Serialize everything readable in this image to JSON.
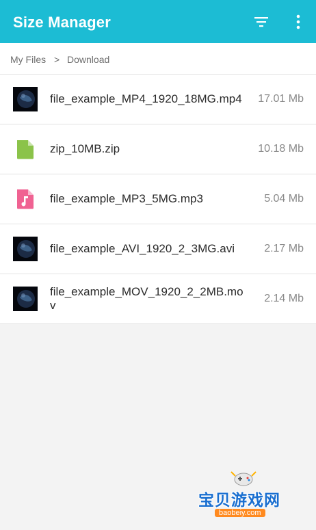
{
  "app": {
    "title": "Size Manager"
  },
  "breadcrumb": {
    "root": "My Files",
    "separator": ">",
    "current": "Download"
  },
  "files": [
    {
      "name": "file_example_MP4_1920_18MG.mp4",
      "size": "17.01 Mb",
      "icon": "video-thumbnail-icon"
    },
    {
      "name": "zip_10MB.zip",
      "size": "10.18 Mb",
      "icon": "file-icon"
    },
    {
      "name": "file_example_MP3_5MG.mp3",
      "size": "5.04 Mb",
      "icon": "music-file-icon"
    },
    {
      "name": "file_example_AVI_1920_2_3MG.avi",
      "size": "2.17 Mb",
      "icon": "video-thumbnail-icon"
    },
    {
      "name": "file_example_MOV_1920_2_2MB.mov",
      "size": "2.14 Mb",
      "icon": "video-thumbnail-icon"
    }
  ],
  "colors": {
    "appbar": "#1cbcd4",
    "zip_icon": "#8bc34a",
    "music_icon": "#f06292"
  },
  "watermark": {
    "text": "宝贝游戏网",
    "domain": "baobeiy.com"
  }
}
